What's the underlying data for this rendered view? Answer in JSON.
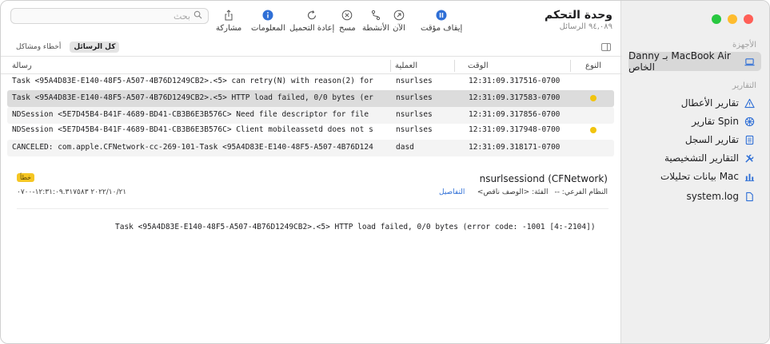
{
  "app": {
    "title": "وحدة التحكم",
    "subtitle": "٩٤,٠٨٩ الرسائل"
  },
  "sidebar": {
    "devices_header": "الأجهزة",
    "device": {
      "label": "Danny بـ MacBook Air الخاص",
      "icon": "laptop-icon"
    },
    "reports_header": "التقارير",
    "items": [
      {
        "label": "تقارير الأعطال",
        "icon": "warning-triangle-icon"
      },
      {
        "label": "تقارير Spin",
        "icon": "spin-wheel-icon"
      },
      {
        "label": "تقارير السجل",
        "icon": "log-document-icon"
      },
      {
        "label": "التقارير التشخيصية",
        "icon": "tools-icon"
      },
      {
        "label": "بيانات تحليلات Mac",
        "icon": "bar-chart-icon"
      },
      {
        "label": "system.log",
        "icon": "file-icon"
      }
    ]
  },
  "toolbar": {
    "pause": "إيقاف مؤقت",
    "now": "الآن",
    "activities": "الأنشطة",
    "clear": "مسح",
    "reload": "إعادة التحميل",
    "info": "المعلومات",
    "share": "مشاركة",
    "search_placeholder": "بحث"
  },
  "filter": {
    "all_messages": "كل الرسائل",
    "errors_faults": "أخطاء ومشاكل"
  },
  "table": {
    "headers": {
      "type": "النوع",
      "time": "الوقت",
      "process": "العملية",
      "message": "رسالة"
    },
    "rows": [
      {
        "message": "Task <95A4D83E-E140-48F5-A507-4B76D1249CB2>.<5> can retry(N) with reason(2) for",
        "process": "nsurlses",
        "time": "12:31:09.317516-0700",
        "dot": false
      },
      {
        "message": "Task <95A4D83E-E140-48F5-A507-4B76D1249CB2>.<5> HTTP load failed, 0/0 bytes (er",
        "process": "nsurlses",
        "time": "12:31:09.317583-0700",
        "dot": true
      },
      {
        "message": "NDSession <5E7D45B4-B41F-4689-BD41-CB3B6E3B576C> Need file descriptor for file",
        "process": "nsurlses",
        "time": "12:31:09.317856-0700",
        "dot": false
      },
      {
        "message": "NDSession <5E7D45B4-B41F-4689-BD41-CB3B6E3B576C> Client mobileassetd does not s",
        "process": "nsurlses",
        "time": "12:31:09.317948-0700",
        "dot": true
      },
      {
        "message": "CANCELED: com.apple.CFNetwork-cc-269-101-Task <95A4D83E-E140-48F5-A507-4B76D124",
        "process": "dasd",
        "time": "12:31:09.318171-0700",
        "dot": false
      }
    ]
  },
  "detail": {
    "title": "nsurlsessiond (CFNetwork)",
    "subsystem": "النظام الفرعي: --",
    "category": "الفئة: <الوصف ناقص>",
    "details_link": "التفاصيل",
    "badge": "خطأ",
    "timestamp": "٢٠٢٢/١٠/٢١ ١٢:٣١:٠٩.٣١٧٥٨٣-٠٧٠٠",
    "message": "Task <95A4D83E-E140-48F5-A507-4B76D1249CB2>.<5> HTTP load failed, 0/0 bytes (error code: -1001 [4:-2104])"
  },
  "colors": {
    "accent": "#2f6fd6",
    "error": "#f1c40f"
  }
}
